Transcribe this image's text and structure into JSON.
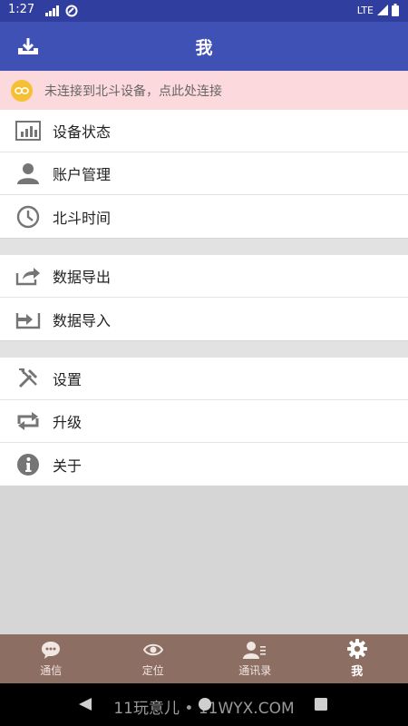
{
  "status_bar": {
    "time": "1:27",
    "network": "LTE"
  },
  "app_bar": {
    "title": "我",
    "left_icon": "download-icon"
  },
  "banner": {
    "icon": "link-icon",
    "text": "未连接到北斗设备，点此处连接"
  },
  "menu_groups": [
    [
      {
        "label": "设备状态",
        "icon": "bar-chart-icon"
      },
      {
        "label": "账户管理",
        "icon": "person-icon"
      },
      {
        "label": "北斗时间",
        "icon": "clock-icon"
      }
    ],
    [
      {
        "label": "数据导出",
        "icon": "share-out-icon"
      },
      {
        "label": "数据导入",
        "icon": "import-icon"
      }
    ],
    [
      {
        "label": "设置",
        "icon": "tools-icon"
      },
      {
        "label": "升级",
        "icon": "repeat-icon"
      },
      {
        "label": "关于",
        "icon": "info-icon"
      }
    ]
  ],
  "bottom_nav": {
    "active_index": 3,
    "tabs": [
      {
        "label": "通信",
        "icon": "chat-bubble-icon"
      },
      {
        "label": "定位",
        "icon": "location-target-icon"
      },
      {
        "label": "通讯录",
        "icon": "contacts-icon"
      },
      {
        "label": "我",
        "icon": "gear-icon"
      }
    ]
  },
  "watermark": "11玩意儿 • 11WYX.COM",
  "colors": {
    "status_bar": "#303f9f",
    "app_bar": "#3f51b5",
    "banner_bg": "#fcd9dc",
    "banner_icon": "#f5c033",
    "bottom_nav": "#8d6e63"
  }
}
